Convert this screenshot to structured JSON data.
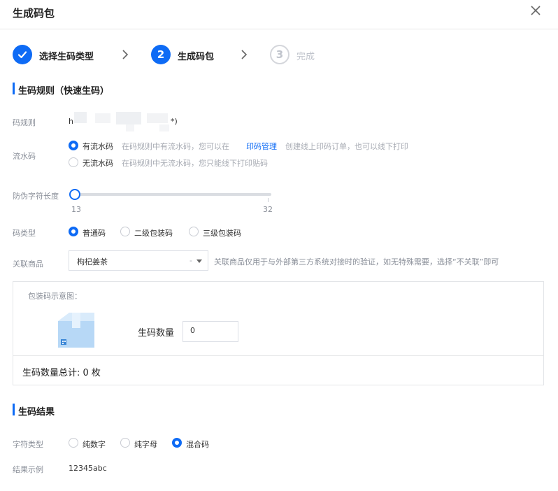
{
  "dialog": {
    "title": "生成码包"
  },
  "steps": [
    {
      "label": "选择生码类型",
      "number": "",
      "state": "done"
    },
    {
      "label": "生成码包",
      "number": "2",
      "state": "active"
    },
    {
      "label": "完成",
      "number": "3",
      "state": "wait"
    }
  ],
  "rules": {
    "section_title": "生码规则（快速生码）",
    "code_rule_label": "码规则",
    "code_rule_prefix": "h",
    "code_rule_suffix": "*)",
    "serial_label": "流水码",
    "serial_options": [
      {
        "label": "有流水码",
        "desc_before": "在码规则中有流水码，您可以在",
        "link": "印码管理",
        "desc_after": "创建线上印码订单，也可以线下打印",
        "checked": true
      },
      {
        "label": "无流水码",
        "desc_before": "在码规则中无流水码，您只能线下打印贴码",
        "link": "",
        "desc_after": "",
        "checked": false
      }
    ],
    "anti_fake_label": "防伪字符长度",
    "slider": {
      "min": "13",
      "max": "32",
      "value": 13
    },
    "code_type_label": "码类型",
    "code_types": [
      {
        "label": "普通码",
        "checked": true
      },
      {
        "label": "二级包装码",
        "checked": false
      },
      {
        "label": "三级包装码",
        "checked": false
      }
    ],
    "product_label": "关联商品",
    "product_value": "枸杞姜茶",
    "product_clear": "-",
    "product_hint": "关联商品仅用于与外部第三方系统对接时的验证，如无特殊需要，选择“不关联”即可",
    "package_title": "包装码示意图：",
    "quantity_label": "生码数量",
    "quantity_value": "0",
    "total_text": "生码数量总计: 0 枚"
  },
  "result": {
    "section_title": "生码结果",
    "char_type_label": "字符类型",
    "char_types": [
      {
        "label": "纯数字",
        "checked": false
      },
      {
        "label": "纯字母",
        "checked": false
      },
      {
        "label": "混合码",
        "checked": true
      }
    ],
    "example_label": "结果示例",
    "example_value": "12345abc"
  },
  "colors": {
    "accent": "#0e6bf5",
    "muted": "#a7abb3",
    "label": "#8a8f99"
  }
}
